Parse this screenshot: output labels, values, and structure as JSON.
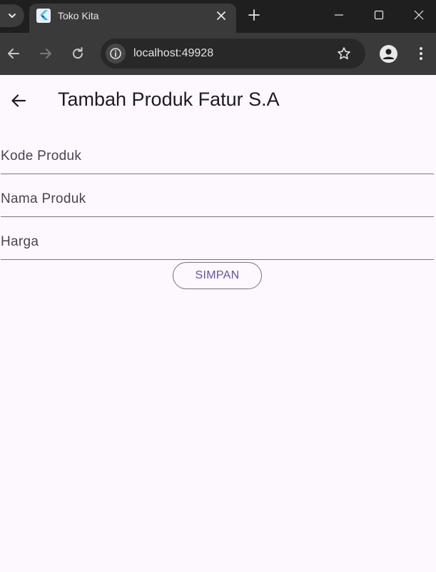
{
  "browser": {
    "tab_title": "Toko Kita",
    "url": "localhost:49928"
  },
  "icons": {
    "tab_search": "chevron-down-icon",
    "favicon": "flutter-logo-icon",
    "tab_close": "close-icon",
    "new_tab": "plus-icon",
    "back": "arrow-left-icon",
    "forward": "arrow-right-icon",
    "reload": "reload-icon",
    "site_info": "info-icon",
    "bookmark": "star-icon",
    "profile": "person-icon",
    "menu": "more-vert-icon"
  },
  "app": {
    "title": "Tambah Produk Fatur S.A",
    "fields": [
      {
        "placeholder": "Kode Produk",
        "value": ""
      },
      {
        "placeholder": "Nama Produk",
        "value": ""
      },
      {
        "placeholder": "Harga",
        "value": ""
      }
    ],
    "save_label": "SIMPAN"
  },
  "colors": {
    "background": "#fdf7fe",
    "primary": "#6750a4",
    "outline": "#79747e",
    "chrome_dark": "#1f1f1f",
    "chrome_toolbar": "#3a3a3a"
  }
}
